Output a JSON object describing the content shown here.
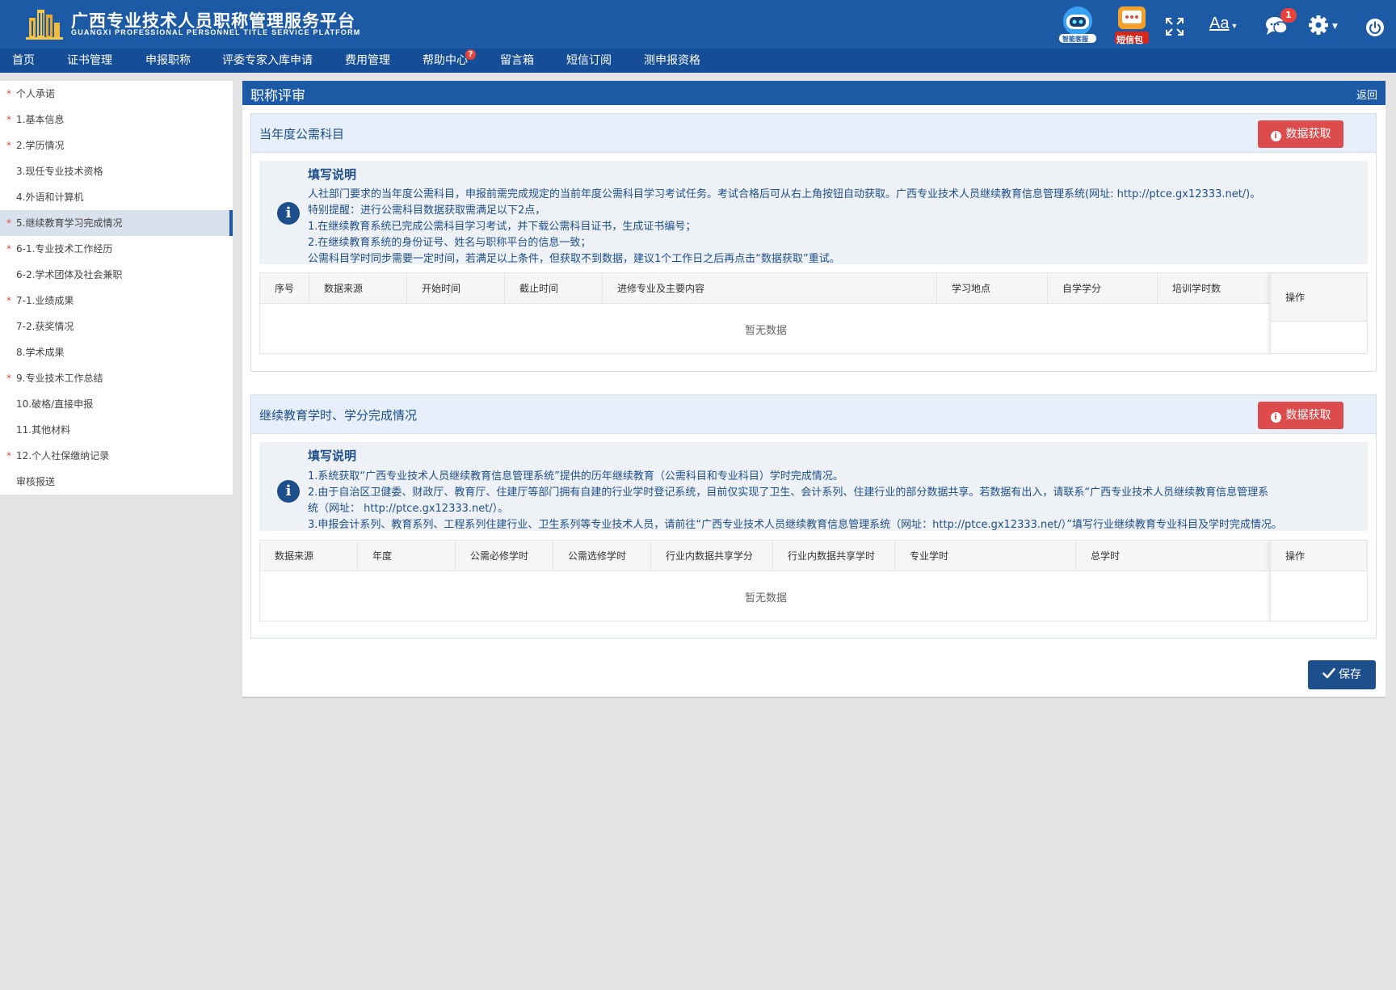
{
  "header": {
    "title": "广西专业技术人员职称管理服务平台",
    "subtitle": "GUANGXI PROFESSIONAL PERSONNEL TITLE SERVICE PLATFORM",
    "robot_label": "智能客服",
    "sms_label": "短信包",
    "font_label": "Aa",
    "message_count": "1"
  },
  "nav": {
    "items": [
      "首页",
      "证书管理",
      "申报职称",
      "评委专家入库申请",
      "费用管理",
      "帮助中心",
      "留言箱",
      "短信订阅",
      "测申报资格"
    ],
    "help_badge": "?"
  },
  "sidebar": {
    "items": [
      {
        "label": "个人承诺",
        "required": true
      },
      {
        "label": "1.基本信息",
        "required": true
      },
      {
        "label": "2.学历情况",
        "required": true
      },
      {
        "label": "3.现任专业技术资格",
        "required": false
      },
      {
        "label": "4.外语和计算机",
        "required": false
      },
      {
        "label": "5.继续教育学习完成情况",
        "required": true,
        "active": true
      },
      {
        "label": "6-1.专业技术工作经历",
        "required": true
      },
      {
        "label": "6-2.学术团体及社会兼职",
        "required": false
      },
      {
        "label": "7-1.业绩成果",
        "required": true
      },
      {
        "label": "7-2.获奖情况",
        "required": false
      },
      {
        "label": "8.学术成果",
        "required": false
      },
      {
        "label": "9.专业技术工作总结",
        "required": true
      },
      {
        "label": "10.破格/直接申报",
        "required": false
      },
      {
        "label": "11.其他材料",
        "required": false
      },
      {
        "label": "12.个人社保缴纳记录",
        "required": true
      },
      {
        "label": "审核报送",
        "required": false
      }
    ],
    "required_mark": "*"
  },
  "main": {
    "title": "职称评审",
    "back": "返回",
    "save": "保存",
    "section1": {
      "title": "当年度公需科目",
      "fetch_button": "数据获取",
      "notice_title": "填写说明",
      "notice_lines": [
        "人社部门要求的当年度公需科目，申报前需完成规定的当前年度公需科目学习考试任务。考试合格后可从右上角按钮自动获取。广西专业技术人员继续教育信息管理系统(网址: http://ptce.gx12333.net/)。",
        "特别提醒：进行公需科目数据获取需满足以下2点，",
        "1.在继续教育系统已完成公需科目学习考试，并下载公需科目证书，生成证书编号；",
        "2.在继续教育系统的身份证号、姓名与职称平台的信息一致；",
        "公需科目学时同步需要一定时间，若满足以上条件，但获取不到数据，建议1个工作日之后再点击“数据获取”重试。"
      ],
      "columns": [
        "序号",
        "数据来源",
        "开始时间",
        "截止时间",
        "进修专业及主要内容",
        "学习地点",
        "自学学分",
        "培训学时数"
      ],
      "op_column": "操作",
      "empty": "暂无数据"
    },
    "section2": {
      "title": "继续教育学时、学分完成情况",
      "fetch_button": "数据获取",
      "notice_title": "填写说明",
      "notice_lines": [
        "1.系统获取“广西专业技术人员继续教育信息管理系统”提供的历年继续教育（公需科目和专业科目）学时完成情况。",
        "2.由于自治区卫健委、财政厅、教育厅、住建厅等部门拥有自建的行业学时登记系统，目前仅实现了卫生、会计系列、住建行业的部分数据共享。若数据有出入，请联系“广西专业技术人员继续教育信息管理系",
        "统（网址： http://ptce.gx12333.net/）。",
        "3.申报会计系列、教育系列、工程系列住建行业、卫生系列等专业技术人员，请前往“广西专业技术人员继续教育信息管理系统（网址：http://ptce.gx12333.net/）”填写行业继续教育专业科目及学时完成情况。"
      ],
      "columns": [
        "数据来源",
        "年度",
        "公需必修学时",
        "公需选修学时",
        "行业内数据共享学分",
        "行业内数据共享学时",
        "专业学时",
        "总学时"
      ],
      "op_column": "操作",
      "empty": "暂无数据"
    }
  },
  "colors": {
    "header": "#1d5aa6",
    "nav": "#154d96",
    "fetch_button": "#dc4c4c",
    "save_button": "#1d4f8c",
    "required_star": "#e24a3b"
  }
}
